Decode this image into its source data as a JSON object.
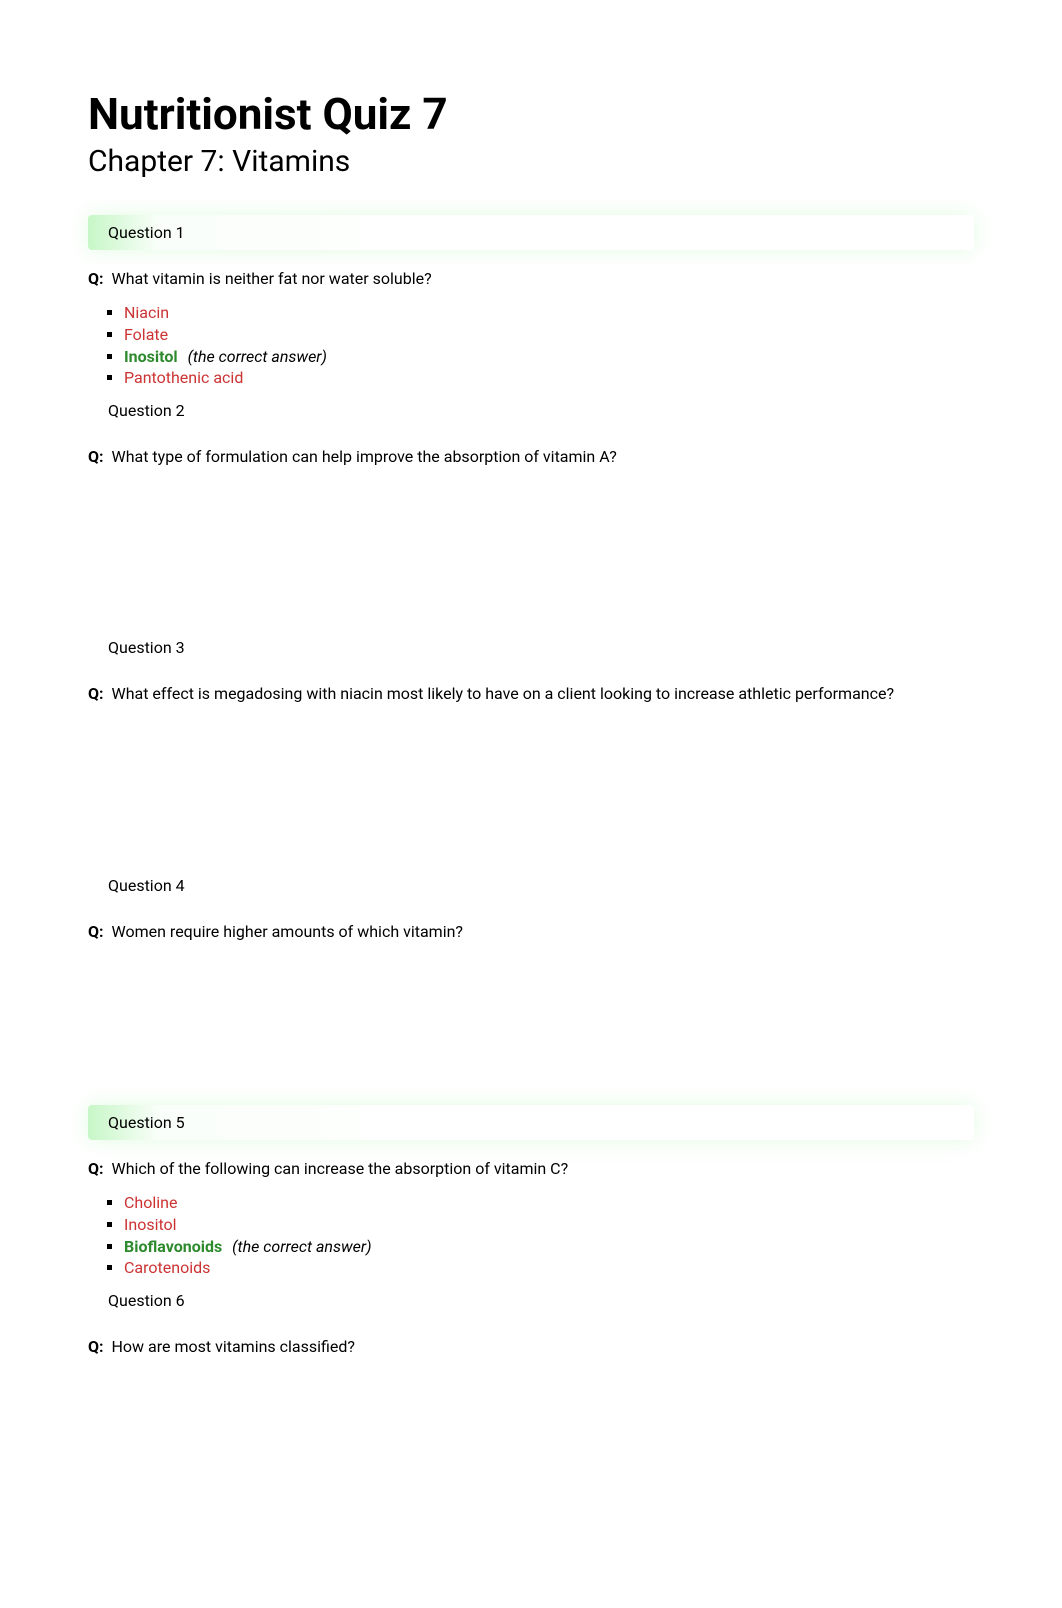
{
  "title": "Nutritionist Quiz 7",
  "subtitle": "Chapter 7: Vitamins",
  "q_prefix": "Q:",
  "correct_hint": "(the correct answer)",
  "questions": [
    {
      "header": "Question 1",
      "highlighted": true,
      "prompt": "What vitamin is neither fat nor water soluble?",
      "answers": [
        {
          "text": "Niacin",
          "correct": false
        },
        {
          "text": "Folate",
          "correct": false
        },
        {
          "text": "Inositol",
          "correct": true
        },
        {
          "text": "Pantothenic acid",
          "correct": false
        }
      ]
    },
    {
      "header": "Question 2",
      "highlighted": false,
      "prompt": "What type of formulation can help improve the absorption of vitamin A?",
      "answers": []
    },
    {
      "header": "Question 3",
      "highlighted": false,
      "prompt": "What effect is megadosing with niacin most likely to have on a client looking to increase athletic performance?",
      "answers": []
    },
    {
      "header": "Question 4",
      "highlighted": false,
      "prompt": "Women require higher amounts of which vitamin?",
      "answers": []
    },
    {
      "header": "Question 5",
      "highlighted": true,
      "prompt": "Which of the following can increase the absorption of vitamin C?",
      "answers": [
        {
          "text": "Choline",
          "correct": false
        },
        {
          "text": "Inositol",
          "correct": false
        },
        {
          "text": "Bioflavonoids",
          "correct": true
        },
        {
          "text": "Carotenoids",
          "correct": false
        }
      ]
    },
    {
      "header": "Question 6",
      "highlighted": false,
      "prompt": "How are most vitamins classified?",
      "answers": []
    }
  ]
}
